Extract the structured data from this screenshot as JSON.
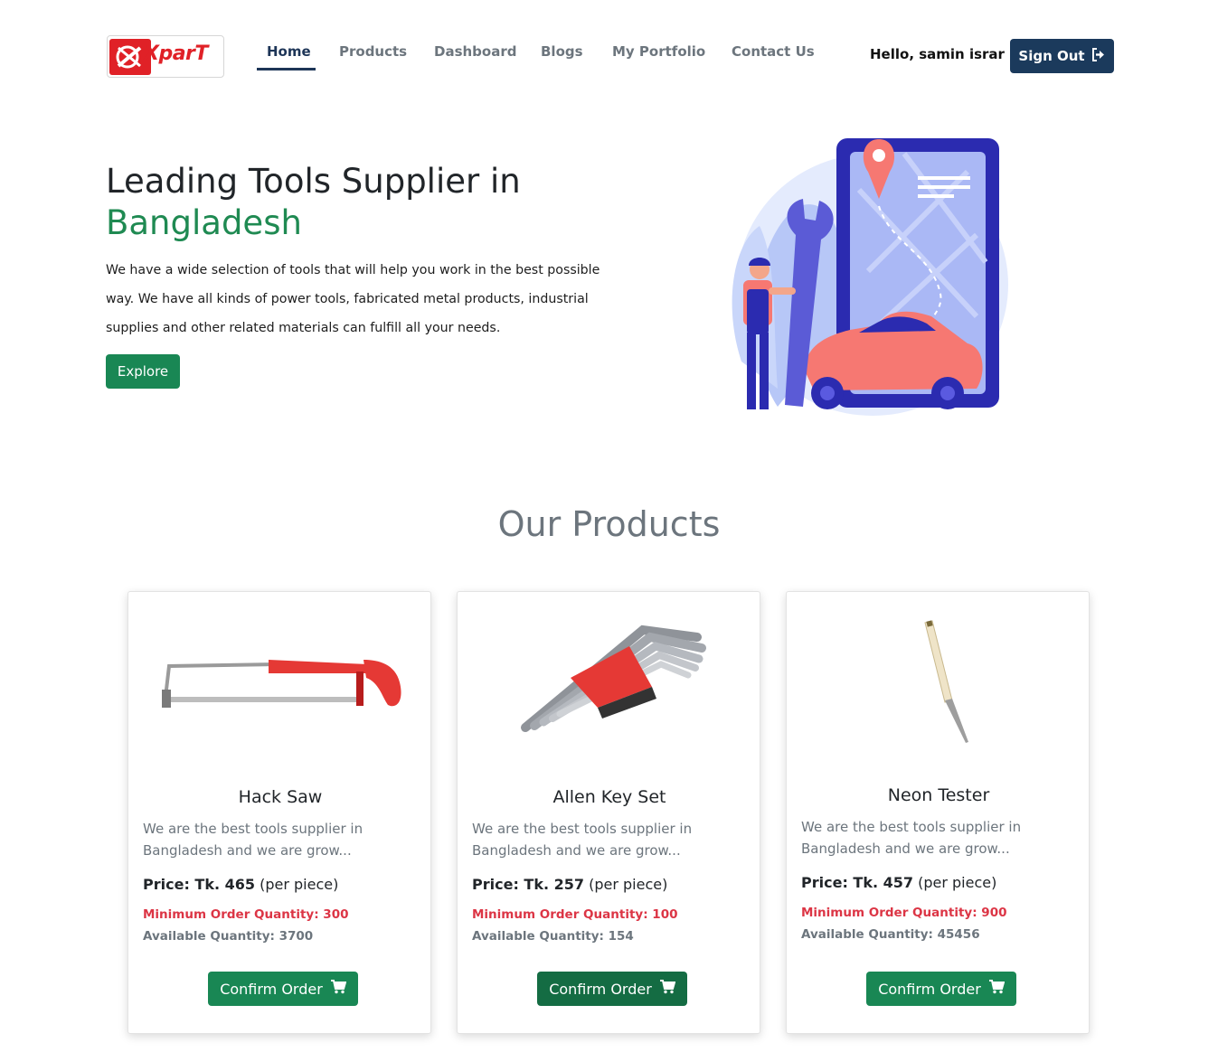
{
  "brand": {
    "logo_text": "XparT"
  },
  "nav": {
    "links": [
      {
        "label": "Home",
        "active": true
      },
      {
        "label": "Products",
        "active": false
      },
      {
        "label": "Dashboard",
        "active": false
      },
      {
        "label": "Blogs",
        "active": false
      },
      {
        "label": "My Portfolio",
        "active": false
      },
      {
        "label": "Contact Us",
        "active": false
      }
    ],
    "greeting": "Hello, samin israr",
    "signout_label": "Sign Out",
    "signout_icon": "sign-out-icon"
  },
  "hero": {
    "title_line1": "Leading Tools Supplier in",
    "title_line2": "Bangladesh",
    "description": "We have a wide selection of tools that will help you work in the best possible way. We have all kinds of power tools, fabricated metal products, industrial supplies and other related materials can fulfill all your needs.",
    "cta_label": "Explore",
    "illustration": "mechanic-with-wrench-phone-map-car-illustration"
  },
  "products": {
    "section_title": "Our Products",
    "items": [
      {
        "name": "Hack Saw",
        "description": "We are the best tools supplier in Bangladesh and we are grow...",
        "price_label": "Price: Tk. 465",
        "price_unit": "(per piece)",
        "min_order": "Minimum Order Quantity: 300",
        "available": "Available Quantity: 3700",
        "button_label": "Confirm Order",
        "image": "hack-saw-image"
      },
      {
        "name": "Allen Key Set",
        "description": "We are the best tools supplier in Bangladesh and we are grow...",
        "price_label": "Price: Tk. 257",
        "price_unit": "(per piece)",
        "min_order": "Minimum Order Quantity: 100",
        "available": "Available Quantity: 154",
        "button_label": "Confirm Order",
        "image": "allen-key-set-image"
      },
      {
        "name": "Neon Tester",
        "description": "We are the best tools supplier in Bangladesh and we are grow...",
        "price_label": "Price: Tk. 457",
        "price_unit": "(per piece)",
        "min_order": "Minimum Order Quantity: 900",
        "available": "Available Quantity: 45456",
        "button_label": "Confirm Order",
        "image": "neon-tester-image"
      }
    ]
  },
  "colors": {
    "primary_green": "#198754",
    "navy": "#1b3a5c",
    "brand_red": "#e02127",
    "danger_red": "#dc3545",
    "muted_gray": "#6c757d"
  }
}
